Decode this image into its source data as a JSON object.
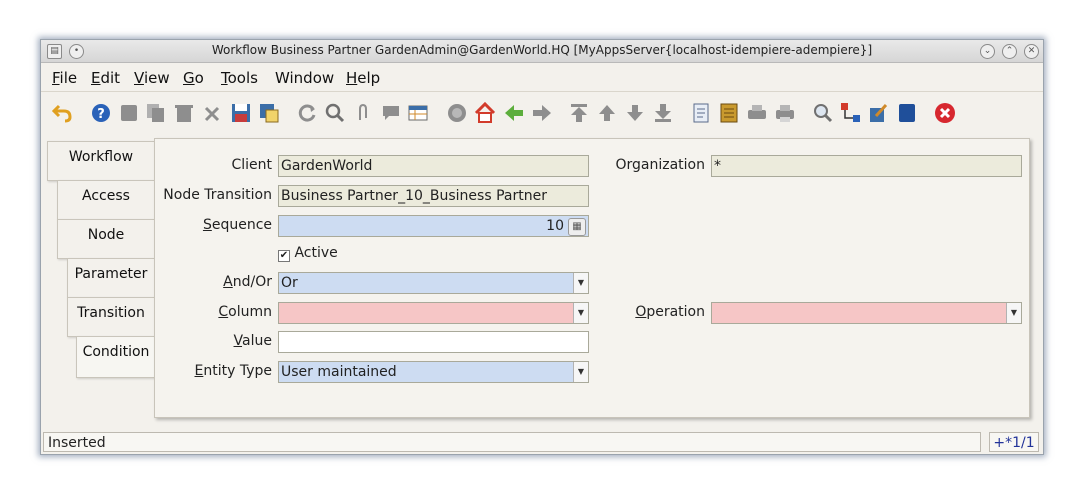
{
  "window": {
    "title": "Workflow  Business Partner  GardenAdmin@GardenWorld.HQ [MyAppsServer{localhost-idempiere-adempiere}]"
  },
  "menu": [
    {
      "label": "File",
      "mnemonic": "F",
      "rest": "ile"
    },
    {
      "label": "Edit",
      "mnemonic": "E",
      "rest": "dit"
    },
    {
      "label": "View",
      "mnemonic": "V",
      "rest": "iew"
    },
    {
      "label": "Go",
      "mnemonic": "G",
      "rest": "o"
    },
    {
      "label": "Tools",
      "mnemonic": "T",
      "rest": "ools"
    },
    {
      "label": "Window",
      "mnemonic": "",
      "rest": "Window"
    },
    {
      "label": "Help",
      "mnemonic": "H",
      "rest": "elp"
    }
  ],
  "toolbar_icons": [
    "undo-icon",
    "help-icon",
    "new-icon",
    "copy-icon",
    "delete-icon",
    "delete-selection-icon",
    "save-icon",
    "save-new-icon",
    "refresh-icon",
    "find-icon",
    "attachment-icon",
    "chat-icon",
    "grid-toggle-icon",
    "history-icon",
    "home-icon",
    "back-icon",
    "forward-icon",
    "first-record-icon",
    "previous-record-icon",
    "next-record-icon",
    "last-record-icon",
    "report-icon",
    "archive-icon",
    "print-preview-icon",
    "print-icon",
    "zoom-across-icon",
    "workflow-icon",
    "request-icon",
    "product-info-icon",
    "end-icon"
  ],
  "tabs": [
    "Workflow",
    "Access",
    "Node",
    "Parameter",
    "Transition",
    "Condition"
  ],
  "form": {
    "client_label": "Client",
    "client_value": "GardenWorld",
    "organization_label": "Organization",
    "organization_value": "*",
    "node_transition_label": "Node Transition",
    "node_transition_value": "Business Partner_10_Business Partner",
    "sequence_label_m": "S",
    "sequence_label_rest": "equence",
    "sequence_value": "10",
    "active_label": "Active",
    "active_checked": true,
    "andor_label_m": "A",
    "andor_label_rest": "nd/Or",
    "andor_value": "Or",
    "column_label_m": "C",
    "column_label_rest": "olumn",
    "column_value": "",
    "operation_label_m": "O",
    "operation_label_rest": "peration",
    "operation_value": "",
    "value_label_m": "V",
    "value_label_rest": "alue",
    "value_value": "",
    "entity_type_label_m": "E",
    "entity_type_label_rest": "ntity Type",
    "entity_type_value": "User maintained"
  },
  "status": {
    "text": "Inserted",
    "record": "+*1/1"
  },
  "colors": {
    "mandatory": "#cddcf2",
    "readonly": "#ecebdc",
    "error": "#f6c6c6"
  }
}
